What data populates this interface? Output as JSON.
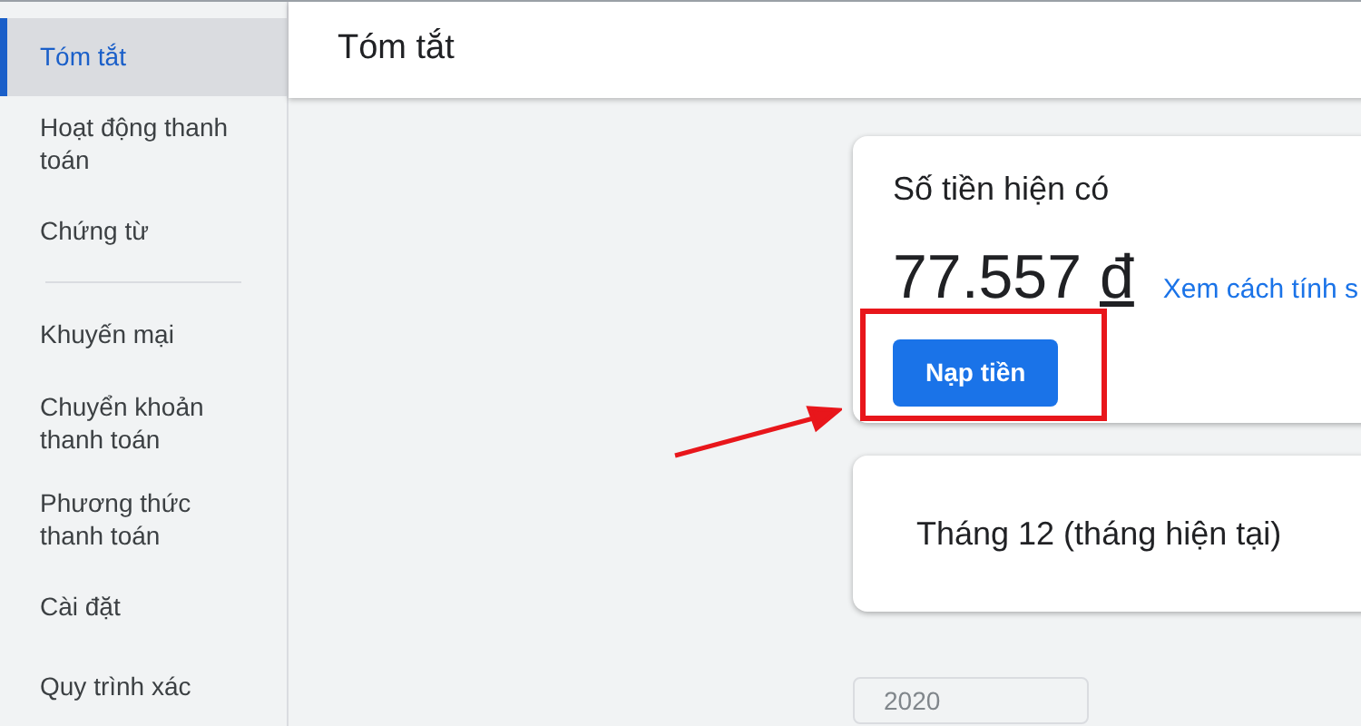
{
  "sidebar": {
    "items": [
      {
        "label": "Tóm tắt",
        "selected": true
      },
      {
        "label": "Hoạt động thanh toán",
        "selected": false
      },
      {
        "label": "Chứng từ",
        "selected": false,
        "divider_after": true
      },
      {
        "label": "Khuyến mại",
        "selected": false
      },
      {
        "label": "Chuyển khoản thanh toán",
        "selected": false
      },
      {
        "label": "Phương thức thanh toán",
        "selected": false
      },
      {
        "label": "Cài đặt",
        "selected": false
      },
      {
        "label": "Quy trình xác",
        "selected": false
      }
    ]
  },
  "header": {
    "title": "Tóm tắt"
  },
  "balance_card": {
    "title": "Số tiền hiện có",
    "amount": "77.557",
    "currency": "đ",
    "link": "Xem cách tính s",
    "button": "Nạp tiền",
    "highlighted": true
  },
  "month_card": {
    "title": "Tháng 12 (tháng hiện tại)"
  },
  "year_select": {
    "value": "2020"
  }
}
